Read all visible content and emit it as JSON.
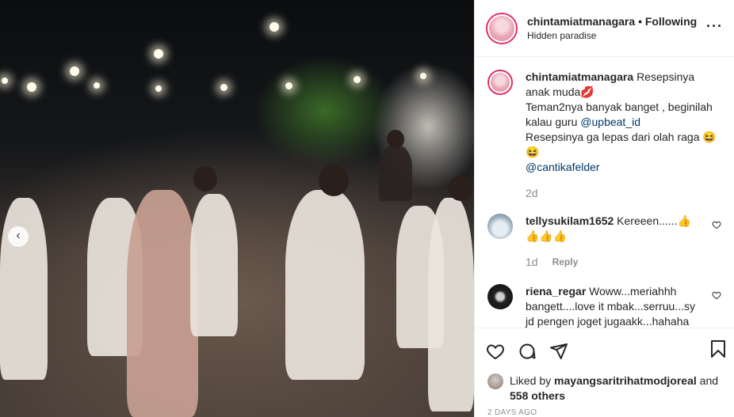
{
  "post": {
    "username": "chintamiatmanagara",
    "separator": "•",
    "follow_status": "Following",
    "location": "Hidden paradise"
  },
  "caption": {
    "username": "chintamiatmanagara",
    "line1": "Resepsinya anak muda",
    "line1_emoji": "💋",
    "line2": "Teman2nya banyak banget , beginilah kalau guru ",
    "line2_mention": "@upbeat_id",
    "line3": "Resepsinya ga lepas dari olah raga ",
    "line3_emoji": "😆😆",
    "line4_mention": "@cantikafelder",
    "time": "2d"
  },
  "comments": [
    {
      "username": "tellysukilam1652",
      "text": " Kereeen......👍",
      "text2": "👍👍👍",
      "time": "1d",
      "reply_label": "Reply"
    },
    {
      "username": "riena_regar",
      "text": " Woww...meriahhh bangett....love it mbak...serruu...sy jd pengen joget jugaakk...hahaha",
      "text2": "😂😍💃💃💃",
      "time": "",
      "reply_label": ""
    }
  ],
  "likes": {
    "prefix": "Liked by ",
    "user": "mayangsaritrihatmodjoreal",
    "middle": " and ",
    "others": "558 others"
  },
  "date": "2 DAYS AGO",
  "icons": {
    "prev": "chevron-left-icon",
    "like": "heart-icon",
    "comment": "comment-icon",
    "share": "share-icon",
    "save": "bookmark-icon",
    "more": "more-options-icon"
  },
  "colors": {
    "accent": "#e1306c",
    "mention": "#00376b",
    "muted": "#8e8e8e"
  }
}
